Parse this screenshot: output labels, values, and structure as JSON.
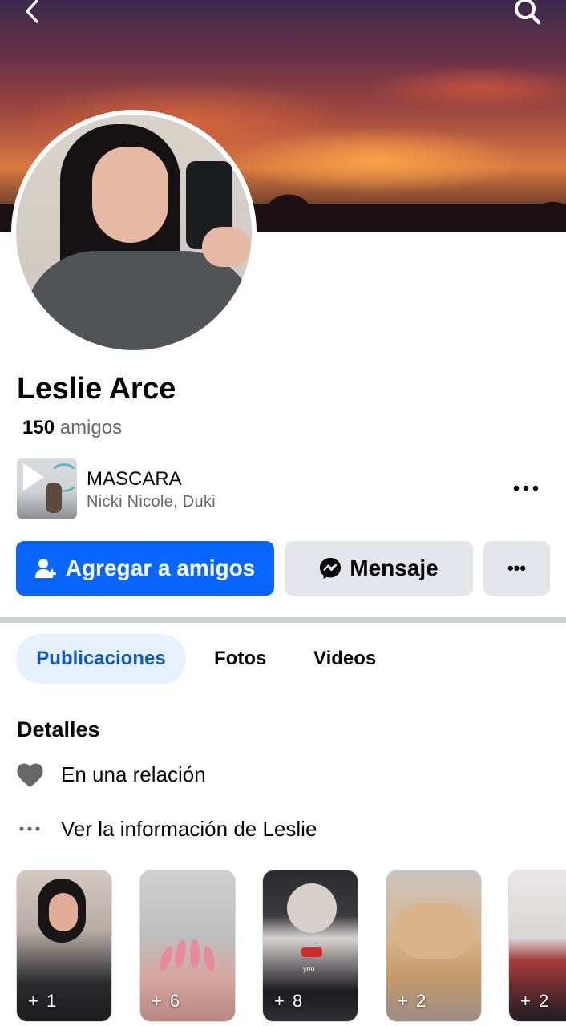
{
  "header": {
    "back_icon": "chevron-left-icon",
    "search_icon": "search-icon"
  },
  "profile": {
    "name": "Leslie Arce",
    "friends_count": "150",
    "friends_label": "amigos"
  },
  "music": {
    "title": "MASCARA",
    "artist": "Nicki Nicole, Duki",
    "more_icon": "more-horizontal-icon"
  },
  "actions": {
    "add_friend_label": "Agregar a amigos",
    "message_label": "Mensaje",
    "more_label": "•••",
    "colors": {
      "primary": "#0866ff",
      "secondary": "#e4e6eb"
    }
  },
  "tabs": [
    {
      "label": "Publicaciones",
      "active": true
    },
    {
      "label": "Fotos",
      "active": false
    },
    {
      "label": "Videos",
      "active": false
    }
  ],
  "details": {
    "title": "Detalles",
    "relationship": "En una relación",
    "see_info": "Ver la información de Leslie"
  },
  "stories": [
    {
      "count": "+ 1"
    },
    {
      "count": "+ 6"
    },
    {
      "count": "+ 8",
      "caption": "you"
    },
    {
      "count": "+ 2"
    },
    {
      "count": "+ 2"
    }
  ]
}
